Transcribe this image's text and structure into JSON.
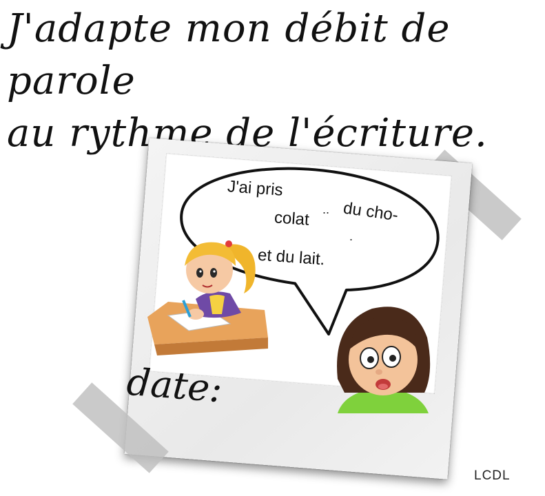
{
  "title": {
    "line1": "J'adapte mon débit de parole",
    "line2": "au rythme de l'écriture."
  },
  "speech_bubble": {
    "part1": "J'ai pris",
    "part2": "du cho-",
    "part3": "colat",
    "part4": "et du lait."
  },
  "date_label": "date:",
  "credit": "LCDL"
}
